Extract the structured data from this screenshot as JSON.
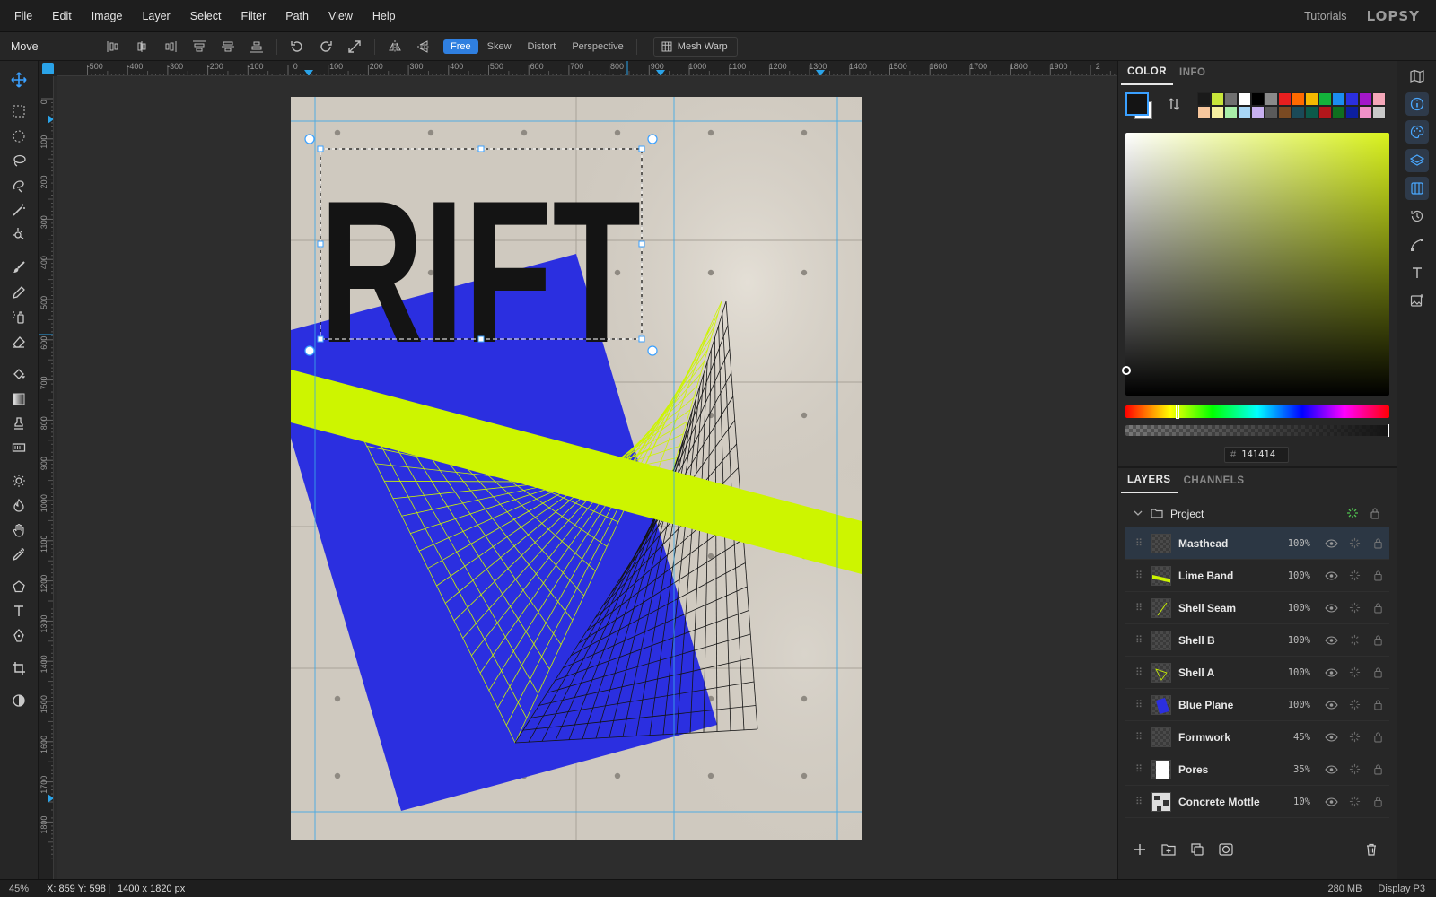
{
  "menu": [
    "File",
    "Edit",
    "Image",
    "Layer",
    "Select",
    "Filter",
    "Path",
    "View",
    "Help"
  ],
  "menu_right": {
    "tutorials": "Tutorials",
    "logo": "LOPSY"
  },
  "options_bar": {
    "tool_name": "Move",
    "transform_modes": [
      {
        "label": "Free",
        "active": true
      },
      {
        "label": "Skew",
        "active": false
      },
      {
        "label": "Distort",
        "active": false
      },
      {
        "label": "Perspective",
        "active": false
      }
    ],
    "mesh_warp_label": "Mesh Warp"
  },
  "rulers": {
    "top_labels": [
      "-500",
      "-400",
      "-300",
      "-200",
      "-100",
      "0",
      "100",
      "200",
      "300",
      "400",
      "500",
      "600",
      "700",
      "800",
      "900",
      "1000",
      "1100",
      "1200",
      "1300",
      "1400",
      "1500",
      "1600",
      "1700",
      "1800",
      "1900",
      "2"
    ],
    "left_labels": [
      "0",
      "100",
      "200",
      "300",
      "400",
      "500",
      "600",
      "700",
      "800",
      "900",
      "1000",
      "1100",
      "1200",
      "1300",
      "1400",
      "1500",
      "1600",
      "1700",
      "1800"
    ]
  },
  "artwork": {
    "title_text": "RIFT",
    "background_color": "#cfc9bf",
    "blue": "#2b2fe0",
    "lime": "#cdf500",
    "ink": "#141414"
  },
  "color_panel": {
    "tabs": [
      {
        "label": "COLOR",
        "active": true
      },
      {
        "label": "INFO",
        "active": false
      }
    ],
    "foreground_color": "#141414",
    "background_color": "#ffffff",
    "hex_value": "141414",
    "palette": [
      "#1a1a1a",
      "#c8e63a",
      "#707070",
      "#ffffff",
      "#000000",
      "#8a8a8a",
      "#e81f1f",
      "#ff6a00",
      "#f5b800",
      "#13b33b",
      "#1b8df0",
      "#2b2fe0",
      "#a317c9",
      "#f4a6b8",
      "#f6c69c",
      "#f6f0a0",
      "#a8eea8",
      "#a8d6f6",
      "#c8b0f0",
      "#5a5a5a",
      "#7a4a22",
      "#1b4a58",
      "#0c5a4a",
      "#b3161b",
      "#0f6f1f",
      "#0d1f9f",
      "#f090c8",
      "#c8c8c8"
    ],
    "hue_fraction": 0.19
  },
  "layers_panel": {
    "tabs": [
      {
        "label": "LAYERS",
        "active": true
      },
      {
        "label": "CHANNELS",
        "active": false
      }
    ],
    "group_name": "Project",
    "layers": [
      {
        "name": "Masthead",
        "opacity": "100%",
        "selected": true
      },
      {
        "name": "Lime Band",
        "opacity": "100%",
        "selected": false
      },
      {
        "name": "Shell Seam",
        "opacity": "100%",
        "selected": false
      },
      {
        "name": "Shell B",
        "opacity": "100%",
        "selected": false
      },
      {
        "name": "Shell A",
        "opacity": "100%",
        "selected": false
      },
      {
        "name": "Blue Plane",
        "opacity": "100%",
        "selected": false
      },
      {
        "name": "Formwork",
        "opacity": "45%",
        "selected": false
      },
      {
        "name": "Pores",
        "opacity": "35%",
        "selected": false
      },
      {
        "name": "Concrete Mottle",
        "opacity": "10%",
        "selected": false
      }
    ]
  },
  "status": {
    "zoom": "45%",
    "coords": "X: 859 Y: 598",
    "dimensions": "1400 x 1820 px",
    "memory": "280 MB",
    "profile": "Display P3"
  }
}
